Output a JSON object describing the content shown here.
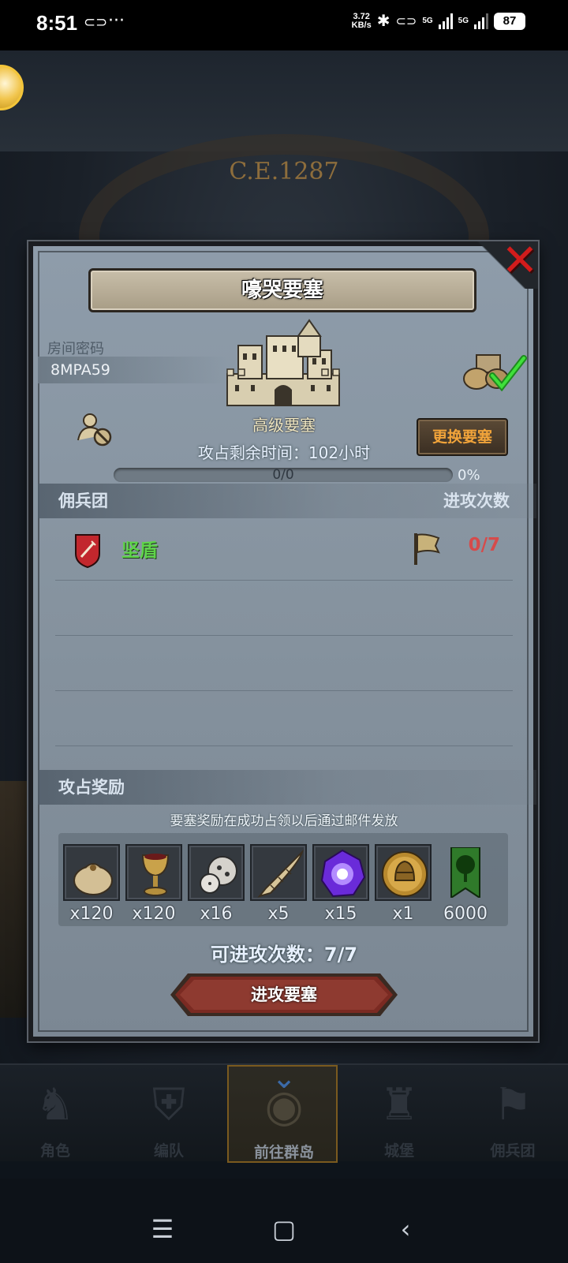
{
  "status_bar": {
    "time": "8:51",
    "more": "···",
    "net_speed_value": "3.72",
    "net_speed_unit": "KB/s",
    "sim1": "5G",
    "sim2": "5G",
    "battery": "87"
  },
  "background": {
    "era": "C.E.1287"
  },
  "dialog": {
    "title": "嚎哭要塞",
    "room_code_label": "房间密码",
    "room_code": "8MPA59",
    "fortress_level": "高级要塞",
    "swap_button": "更换要塞",
    "remaining_time": "攻占剩余时间：102小时",
    "progress": {
      "label": "0/0",
      "percent_text": "0%",
      "fraction": 0
    },
    "mercenary_header": "佣兵团",
    "attack_times_header": "进攻次数",
    "mercenary": {
      "name": "坚盾",
      "attacks": "0/7"
    },
    "rewards_header": "攻占奖励",
    "rewards_note": "要塞奖励在成功占领以后通过邮件发放",
    "rewards": [
      {
        "icon": "coin-bag-icon",
        "qty": "x120"
      },
      {
        "icon": "goblet-icon",
        "qty": "x120"
      },
      {
        "icon": "ore-icon",
        "qty": "x16"
      },
      {
        "icon": "horn-icon",
        "qty": "x5"
      },
      {
        "icon": "purple-crystal-icon",
        "qty": "x15"
      },
      {
        "icon": "helmet-medal-icon",
        "qty": "x1"
      },
      {
        "icon": "tree-banner-icon",
        "qty": "6000"
      }
    ],
    "attack_count": "可进攻次数：7/7",
    "attack_button": "进攻要塞"
  },
  "bottom_nav": [
    {
      "label": "角色",
      "icon": "character-icon"
    },
    {
      "label": "编队",
      "icon": "formation-icon"
    },
    {
      "label": "前往群岛",
      "icon": "island-icon",
      "active": true
    },
    {
      "label": "城堡",
      "icon": "castle-icon"
    },
    {
      "label": "佣兵团",
      "icon": "mercenary-icon"
    }
  ],
  "colors": {
    "dialog_bg": "#8e9caa",
    "merc_name": "#5fd34a",
    "attack_red": "#d64b4b",
    "swap_text": "#f2a43a",
    "close_red": "#d21c1c"
  }
}
